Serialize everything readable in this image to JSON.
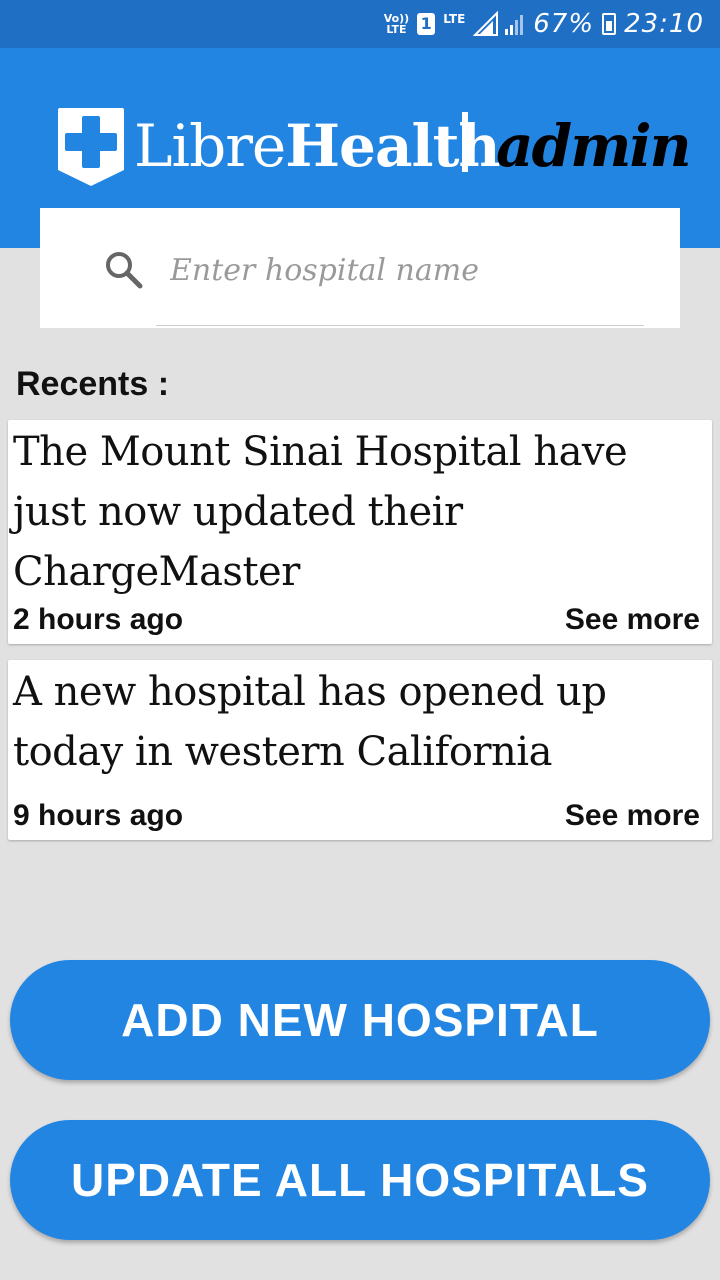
{
  "status_bar": {
    "volte_top": "Vo))",
    "volte_bottom": "LTE",
    "sim_slot": "1",
    "network_type": "LTE",
    "battery_percent": "67%",
    "time": "23:10"
  },
  "header": {
    "brand_part1": "Libre",
    "brand_part2": "Health",
    "role": "admin"
  },
  "search": {
    "placeholder": "Enter hospital name",
    "value": ""
  },
  "recents": {
    "title": "Recents :",
    "items": [
      {
        "text": "The Mount Sinai Hospital have just now updated their ChargeMaster",
        "time": "2 hours ago",
        "action": "See more"
      },
      {
        "text": "A new hospital has opened up today in western California",
        "time": "9 hours ago",
        "action": "See more"
      }
    ]
  },
  "buttons": {
    "add_hospital": "ADD NEW HOSPITAL",
    "update_all": "UPDATE ALL HOSPITALS"
  },
  "colors": {
    "status_bar": "#1f6fc5",
    "primary": "#2285e2",
    "background": "#e2e1e2",
    "card": "#ffffff"
  },
  "icons": {
    "logo": "medical-cross-shield-icon",
    "search": "search-icon",
    "sim": "sim-card-icon",
    "signal": "signal-strength-icon",
    "battery": "battery-icon"
  }
}
